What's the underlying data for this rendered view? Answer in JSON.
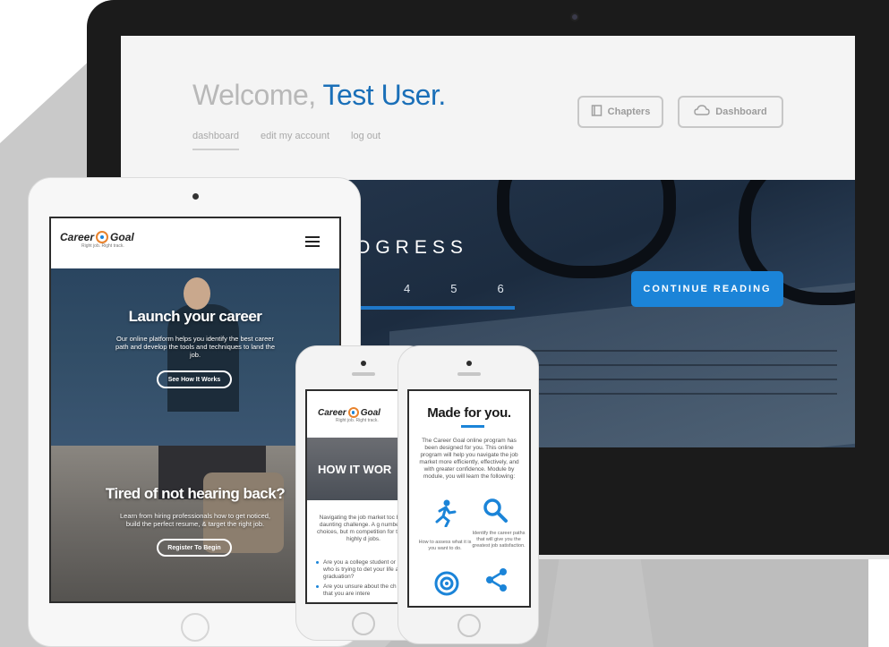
{
  "desktop": {
    "welcome_prefix": "Welcome,",
    "welcome_user": "Test User.",
    "nav": [
      "dashboard",
      "edit my account",
      "log out"
    ],
    "buttons": {
      "chapters": "Chapters",
      "dashboard": "Dashboard"
    },
    "progress_title": "OGRESS",
    "steps": [
      "4",
      "5",
      "6"
    ],
    "continue_label": "CONTINUE READING"
  },
  "ipad": {
    "logo_text_left": "Career",
    "logo_text_right": "Goal",
    "logo_sub": "Right job. Right track.",
    "hero1_title": "Launch your career",
    "hero1_text": "Our online platform helps you identify the best career path and develop the tools and techniques to land the job.",
    "hero1_button": "See How It Works",
    "hero2_title": "Tired of not hearing back?",
    "hero2_text": "Learn from hiring professionals how to get noticed, build the perfect resume, & target the right job.",
    "hero2_button": "Register To Begin"
  },
  "iphone1": {
    "logo_text_left": "Career",
    "logo_text_right": "Goal",
    "logo_sub": "Right job. Right track.",
    "hero_title": "HOW IT WOR",
    "body": "Navigating the job market toc be a daunting challenge. A g number of choices, but m competition for those highly d jobs.",
    "bullets": [
      "Are you a college student or graduate who is trying to det your life after graduation?",
      "Are you unsure about the ch the career that you are intere"
    ]
  },
  "iphone2": {
    "title": "Made for you.",
    "text": "The Career Goal online program has been designed for you. This online program will help you navigate the job market more efficiently, effectively, and with greater confidence. Module by module, you will learn the following:",
    "feature1": "How to assess what it is you want to do.",
    "feature2": "Identify the career paths that will give you the greatest job satisfaction."
  },
  "colors": {
    "accent": "#1b84d8",
    "user_name": "#1a6fb8",
    "logo_orange": "#e8822c"
  }
}
